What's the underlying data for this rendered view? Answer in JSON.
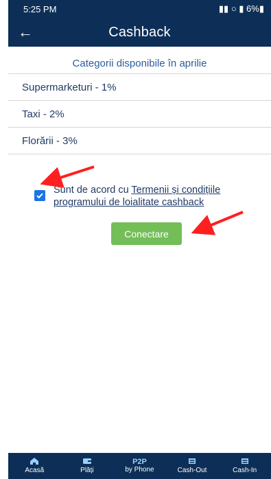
{
  "status_bar": {
    "time": "5:25 PM",
    "right": "▮▮ ○ ▮ 6%▮"
  },
  "app_bar": {
    "title": "Cashback",
    "back_icon": "←"
  },
  "subtitle": "Categorii disponibile în aprilie",
  "categories": [
    "Supermarketuri - 1%",
    "Taxi - 2%",
    "Florării - 3%"
  ],
  "consent": {
    "checked": true,
    "prefix": "Sunt de acord cu ",
    "link": "Termenii și condițiile programului de loialitate cashback"
  },
  "buttons": {
    "connect": "Conectare"
  },
  "bottom_nav": [
    {
      "label": "Acasă",
      "icon": "home-icon"
    },
    {
      "label": "Plăți",
      "icon": "wallet-icon"
    },
    {
      "label": "by Phone",
      "icon": "p2p-icon",
      "top": "P2P"
    },
    {
      "label": "Cash-Out",
      "icon": "cash-out-icon"
    },
    {
      "label": "Cash-In",
      "icon": "cash-in-icon"
    }
  ],
  "colors": {
    "primary": "#0d2f57",
    "accent": "#74be57",
    "checkbox": "#1a73e8",
    "arrow": "#ff1f1f"
  }
}
